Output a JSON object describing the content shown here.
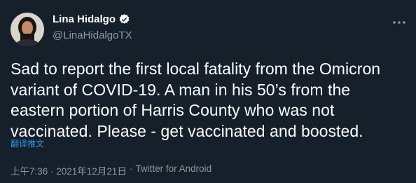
{
  "author": {
    "display_name": "Lina Hidalgo",
    "handle": "@LinaHidalgoTX",
    "verified": true
  },
  "tweet": {
    "lines": [
      "Sad to report the first local fatality from the Omicron",
      "variant of COVID-19. A man in his 50’s from the",
      "eastern portion of Harris County who was not",
      "vaccinated. Please - get vaccinated and boosted."
    ],
    "translate_label": "翻译推文",
    "timestamp": "上午7:36 · 2021年12月21日",
    "separator": "·",
    "source": "Twitter for Android"
  },
  "icons": {
    "verified": "verified-badge-icon",
    "more": "more-options-icon",
    "avatar": "profile-photo"
  },
  "colors": {
    "background": "#15202b",
    "text": "#ffffff",
    "secondary": "#8b98a5",
    "accent": "#1d9bf0"
  }
}
